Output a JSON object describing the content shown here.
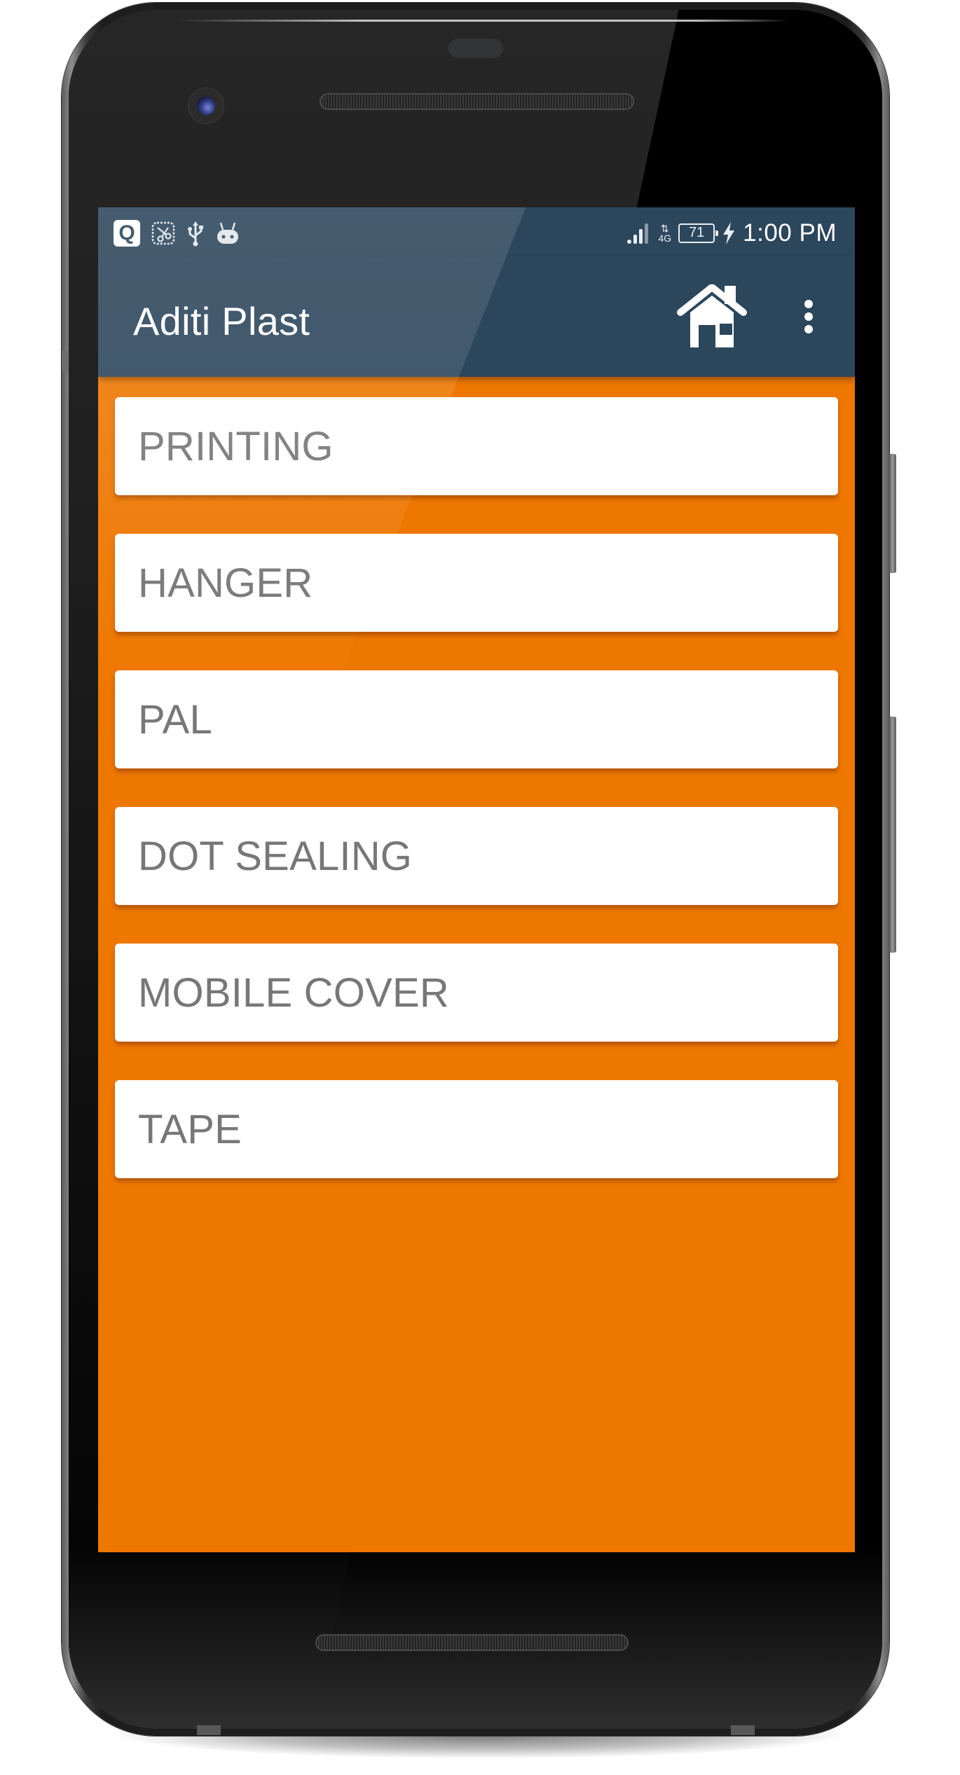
{
  "status_bar": {
    "notification_icons": [
      "quick-app-icon",
      "screenshot-scissors-icon",
      "usb-icon",
      "android-debug-icon"
    ],
    "q_letter": "Q",
    "network_type": "4G",
    "signal_bars_filled": 3,
    "signal_bars_total": 4,
    "battery_level": "71",
    "charging": true,
    "time": "1:00 PM"
  },
  "toolbar": {
    "title": "Aditi Plast",
    "actions": [
      "home-icon",
      "more-vert-icon"
    ]
  },
  "categories": [
    {
      "label": "PRINTING"
    },
    {
      "label": "HANGER"
    },
    {
      "label": "PAL"
    },
    {
      "label": "DOT SEALING"
    },
    {
      "label": "MOBILE COVER"
    },
    {
      "label": "TAPE"
    }
  ],
  "colors": {
    "toolbar_bg": "#2C465C",
    "content_bg": "#EE7700",
    "card_bg": "#FFFFFF",
    "card_text": "#777777",
    "title_text": "#FFFFFF"
  }
}
